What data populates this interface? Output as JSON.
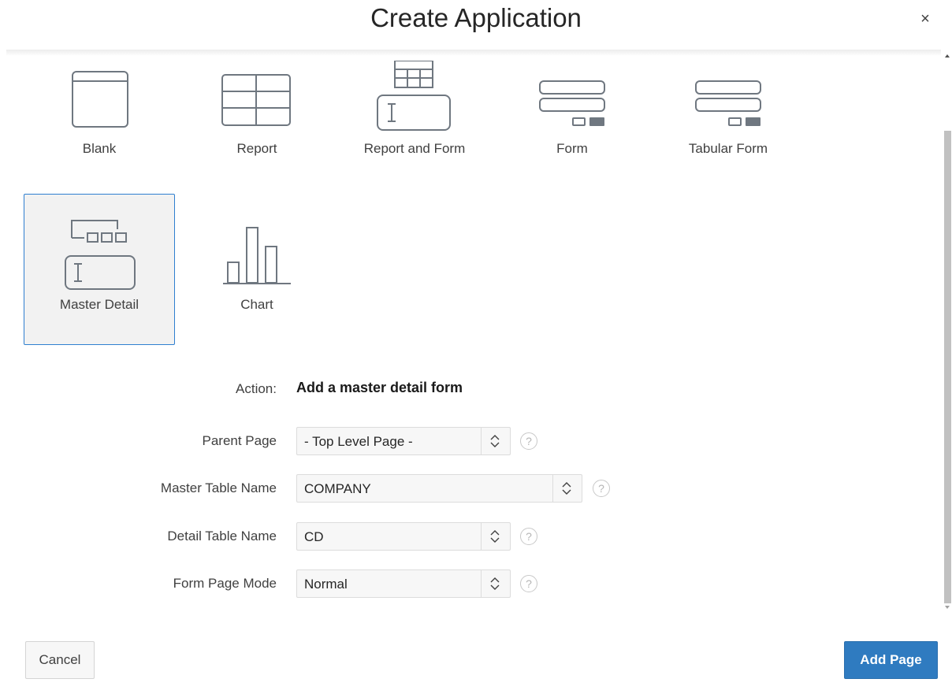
{
  "dialog": {
    "title": "Create Application",
    "close_glyph": "×"
  },
  "page_types": [
    {
      "label": "Blank",
      "icon": "blank-page-icon",
      "selected": false
    },
    {
      "label": "Report",
      "icon": "report-icon",
      "selected": false
    },
    {
      "label": "Report and Form",
      "icon": "report-and-form-icon",
      "selected": false
    },
    {
      "label": "Form",
      "icon": "form-icon",
      "selected": false
    },
    {
      "label": "Tabular Form",
      "icon": "tabular-form-icon",
      "selected": false
    },
    {
      "label": "Master Detail",
      "icon": "master-detail-icon",
      "selected": true
    },
    {
      "label": "Chart",
      "icon": "chart-icon",
      "selected": false
    }
  ],
  "form": {
    "action": {
      "label": "Action:",
      "value": "Add a master detail form"
    },
    "parent_page": {
      "label": "Parent Page",
      "value": "- Top Level Page -"
    },
    "master_table": {
      "label": "Master Table Name",
      "value": "COMPANY"
    },
    "detail_table": {
      "label": "Detail Table Name",
      "value": "CD"
    },
    "form_page_mode": {
      "label": "Form Page Mode",
      "value": "Normal"
    },
    "help_glyph": "?"
  },
  "footer": {
    "cancel_label": "Cancel",
    "add_page_label": "Add Page"
  },
  "colors": {
    "selected_border": "#2f7fd0",
    "selected_bg": "#f2f2f2",
    "primary_button": "#2f7bc0",
    "icon_stroke": "#6f7780"
  }
}
